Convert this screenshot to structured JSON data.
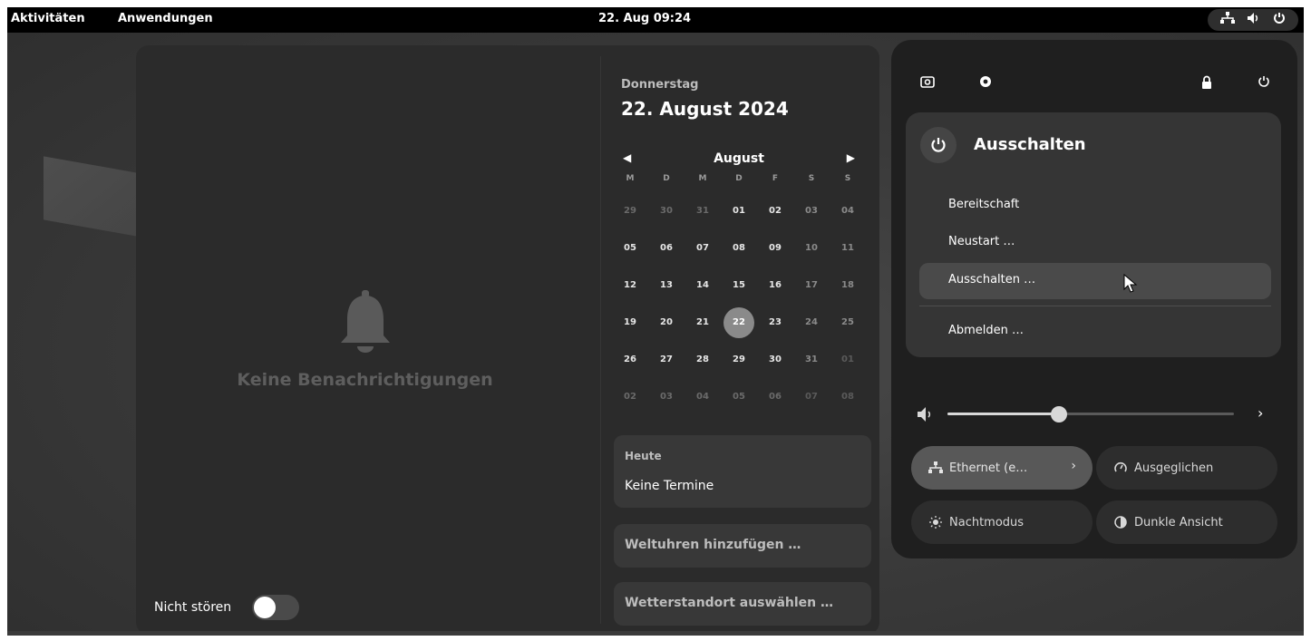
{
  "topbar": {
    "activities": "Aktivitäten",
    "applications": "Anwendungen",
    "clock": "22. Aug 09:24",
    "tray_icons": [
      "network-wired-icon",
      "volume-icon",
      "power-icon"
    ]
  },
  "notifications": {
    "empty_message": "Keine Benachrichtigungen",
    "dnd_label": "Nicht stören",
    "dnd_enabled": false
  },
  "calendar": {
    "weekday": "Donnerstag",
    "date": "22. August 2024",
    "month": "August",
    "weekday_headers": [
      "M",
      "D",
      "M",
      "D",
      "F",
      "S",
      "S"
    ],
    "weeks": [
      [
        "29",
        "30",
        "31",
        "01",
        "02",
        "03",
        "04"
      ],
      [
        "05",
        "06",
        "07",
        "08",
        "09",
        "10",
        "11"
      ],
      [
        "12",
        "13",
        "14",
        "15",
        "16",
        "17",
        "18"
      ],
      [
        "19",
        "20",
        "21",
        "22",
        "23",
        "24",
        "25"
      ],
      [
        "26",
        "27",
        "28",
        "29",
        "30",
        "31",
        "01"
      ],
      [
        "02",
        "03",
        "04",
        "05",
        "06",
        "07",
        "08"
      ]
    ],
    "today": "22",
    "events_title": "Heute",
    "events_body": "Keine Termine",
    "world_clocks_label": "Weltuhren hinzufügen …",
    "weather_label": "Wetterstandort auswählen …"
  },
  "quick_settings": {
    "power_menu": {
      "title": "Ausschalten",
      "items": [
        "Bereitschaft",
        "Neustart …",
        "Ausschalten …",
        "Abmelden …"
      ],
      "selected": "Ausschalten …"
    },
    "volume_level": 0.39,
    "toggles": {
      "ethernet": "Ethernet (e…",
      "power_mode": "Ausgeglichen",
      "night_light": "Nachtmodus",
      "dark_style": "Dunkle Ansicht"
    }
  },
  "colors": {
    "panel": "#2b2b2b",
    "quick_settings": "#1f1f1f",
    "accent": "#8a8a8a"
  }
}
